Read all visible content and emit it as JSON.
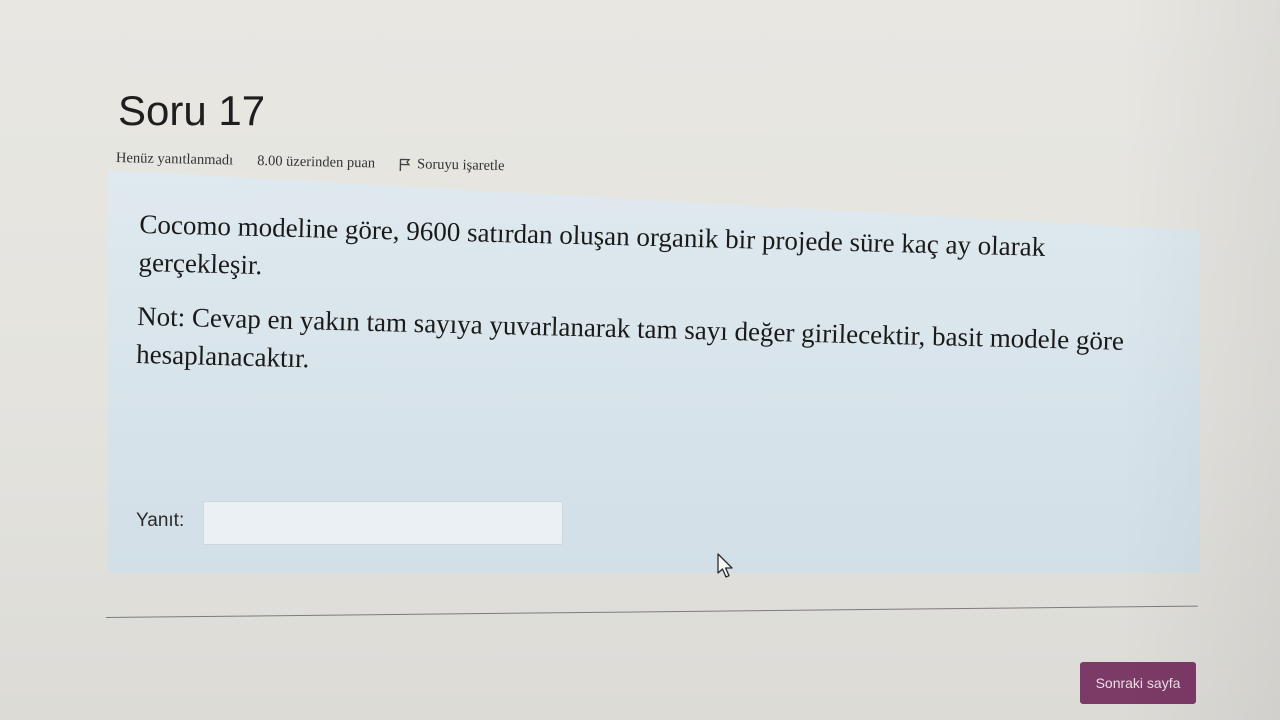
{
  "question": {
    "title": "Soru 17",
    "status": "Henüz yanıtlanmadı",
    "grade": "8.00 üzerinden puan",
    "flag_label": "Soruyu işaretle",
    "flag_icon": "flag-icon",
    "text": "Cocomo modeline göre, 9600 satırdan oluşan organik bir projede süre kaç ay olarak gerçekleşir.",
    "note": "Not: Cevap en yakın tam sayıya yuvarlanarak tam sayı değer girilecektir, basit modele göre hesaplanacaktır.",
    "answer_label": "Yanıt:",
    "answer_value": ""
  },
  "navigation": {
    "next_label": "Sonraki sayfa",
    "next_color": "#7c3a66"
  },
  "colors": {
    "question_background": "#d6e2ea",
    "page_background": "#e7e6e1"
  }
}
